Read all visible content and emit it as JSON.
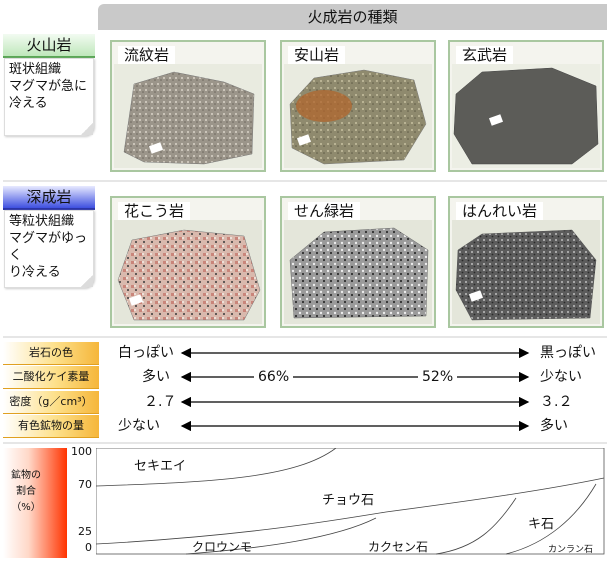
{
  "title": "火成岩の種類",
  "groups": [
    {
      "name": "火山岩",
      "texture": "斑状組織",
      "desc1": "マグマが急に",
      "desc2": "冷える",
      "rocks": [
        "流紋岩",
        "安山岩",
        "玄武岩"
      ]
    },
    {
      "name": "深成岩",
      "texture": "等粒状組織",
      "desc1": "マグマがゆっく",
      "desc2": "り冷える",
      "rocks": [
        "花こう岩",
        "せん緑岩",
        "はんれい岩"
      ]
    }
  ],
  "properties": [
    {
      "label": "岩石の色",
      "left": "白っぽい",
      "right": "黒っぽい",
      "mid1": "",
      "mid2": ""
    },
    {
      "label": "二酸化ケイ素量",
      "left": "多い",
      "right": "少ない",
      "mid1": "66%",
      "mid2": "52%"
    },
    {
      "label": "密度（g／cm³）",
      "left": "２.７",
      "right": "３.２",
      "mid1": "",
      "mid2": ""
    },
    {
      "label": "有色鉱物の量",
      "left": "少ない",
      "right": "多い",
      "mid1": "",
      "mid2": ""
    }
  ],
  "mineral_chart": {
    "ylabel_lines": [
      "鉱物の",
      "割合",
      "（%）"
    ],
    "ticks": [
      "100",
      "70",
      "25",
      "0"
    ],
    "regions": [
      "セキエイ",
      "チョウ石",
      "キ石",
      "クロウンモ",
      "カクセン石",
      "カンラン石"
    ]
  },
  "colors": {
    "green_frame": "#a9c7a0",
    "blue_tab": "#3e4fe0",
    "orange_label": "#f5b63a",
    "chart_left": "#ff3300"
  }
}
